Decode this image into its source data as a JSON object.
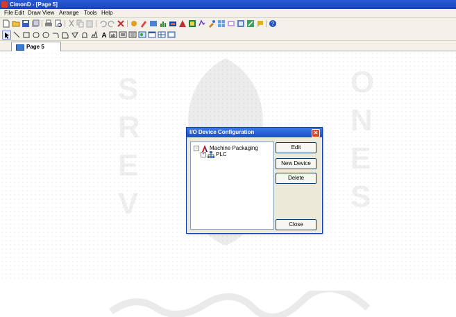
{
  "window": {
    "title": "CimonD - [Page 5]"
  },
  "menu": [
    "File",
    "Edit",
    "Draw",
    "View",
    "Arrange",
    "Tools",
    "Help"
  ],
  "toolbar1_icons": [
    "new-icon",
    "open-icon",
    "save-icon",
    "save-all-icon",
    "print-icon",
    "print-preview-icon",
    "cut-icon",
    "copy-icon",
    "paste-icon",
    "undo-icon",
    "redo-icon",
    "delete-icon",
    "tag-icon",
    "draw-icon",
    "screen-icon",
    "chart-icon",
    "device-icon",
    "alarm-icon",
    "data-icon",
    "script-icon",
    "tool-icon",
    "grid-icon",
    "table-icon",
    "zoom-icon",
    "help-icon"
  ],
  "toolbar2_icons": [
    "select-icon",
    "line-icon",
    "rectangle-icon",
    "ellipse-icon",
    "circle-icon",
    "arc-icon",
    "polygon-icon",
    "polyline-icon",
    "bezier-icon",
    "spline-icon",
    "text-icon",
    "text-box-icon",
    "bitmap-icon",
    "button-icon",
    "image-icon",
    "panel-icon",
    "table-tool-icon",
    "frame-icon"
  ],
  "tabs": [
    {
      "label": "Page 5"
    }
  ],
  "dialog": {
    "title": "I/O Device Configuration",
    "tree": [
      {
        "label": "Machine Packaging",
        "expander": "−"
      },
      {
        "label": "PLC",
        "expander": "+"
      }
    ],
    "buttons": {
      "edit": "Edit",
      "new_device": "New Device",
      "delete": "Delete",
      "close": "Close"
    }
  },
  "colors": {
    "titlebar": "#1844b8",
    "dialog_title": "#2b64dd",
    "chrome": "#f2f0e8",
    "dialog_bg": "#ece9d8"
  }
}
